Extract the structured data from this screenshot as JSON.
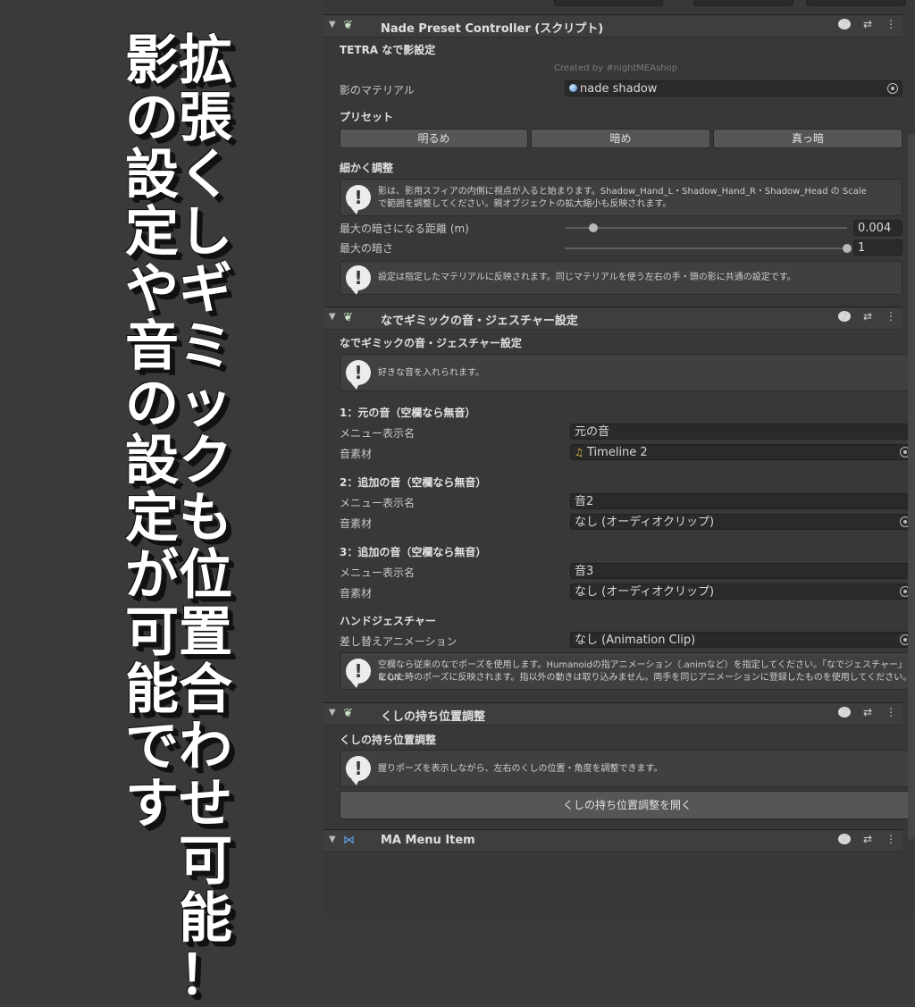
{
  "overlay": {
    "col1": [
      "影",
      "の",
      "設",
      "定",
      "や",
      "音",
      "の",
      "設",
      "定",
      "が",
      "可",
      "能",
      "で",
      "す"
    ],
    "col2": [
      "拡",
      "張",
      "く",
      "し",
      "ギ",
      "ミ",
      "ッ",
      "ク",
      "も",
      "位",
      "置",
      "合",
      "わ",
      "せ",
      "可",
      "能",
      "！"
    ]
  },
  "comp1": {
    "title": "Nade Preset Controller (スクリプト)",
    "subtitle": "TETRA なで影設定",
    "credit": "Created by #nightMEAshop",
    "material_label": "影のマテリアル",
    "material_value": "nade shadow",
    "preset_label": "プリセット",
    "preset_buttons": [
      "明るめ",
      "暗め",
      "真っ暗"
    ],
    "fine_label": "細かく調整",
    "help1_line1": "影は、影用スフィアの内側に視点が入ると始まります。Shadow_Hand_L・Shadow_Hand_R・Shadow_Head の Scale",
    "help1_line2": "で範囲を調整してください。親オブジェクトの拡大縮小も反映されます。",
    "dist_label": "最大の暗さになる距離 (m)",
    "dist_value": "0.004",
    "dark_label": "最大の暗さ",
    "dark_value": "1",
    "dist_fraction": 0.1,
    "dark_fraction": 1.0,
    "help2": "設定は指定したマテリアルに反映されます。同じマテリアルを使う左右の手・頭の影に共通の設定です。"
  },
  "comp2": {
    "title": "なでギミックの音・ジェスチャー設定",
    "subtitle": "なでギミックの音・ジェスチャー設定",
    "help": "好きな音を入れられます。",
    "sound1_header": "1：元の音（空欄なら無音）",
    "sound1_menu_label": "メニュー表示名",
    "sound1_menu_value": "元の音",
    "sound1_clip_label": "音素材",
    "sound1_clip_value": "Timeline 2",
    "sound2_header": "2：追加の音（空欄なら無音）",
    "sound2_menu_label": "メニュー表示名",
    "sound2_menu_value": "音2",
    "sound2_clip_label": "音素材",
    "sound2_clip_value": "なし (オーディオクリップ)",
    "sound3_header": "3：追加の音（空欄なら無音）",
    "sound3_menu_label": "メニュー表示名",
    "sound3_menu_value": "音3",
    "sound3_clip_label": "音素材",
    "sound3_clip_value": "なし (オーディオクリップ)",
    "gesture_header": "ハンドジェスチャー",
    "anim_label": "差し替えアニメーション",
    "anim_value": "なし (Animation Clip)",
    "help_gesture_line1": "空欄なら従来のなでポーズを使用します。Humanoidの指アニメーション（.animなど）を指定してください。「なでジェスチャー」をON",
    "help_gesture_line2": "にした時のポーズに反映されます。指以外の動きは取り込みません。両手を同じアニメーションに登録したものを使用してください。"
  },
  "comp3": {
    "title": "くしの持ち位置調整",
    "subtitle": "くしの持ち位置調整",
    "help": "握りポーズを表示しながら、左右のくしの位置・角度を調整できます。",
    "button": "くしの持ち位置調整を開く"
  },
  "comp4": {
    "title": "MA Menu Item"
  },
  "icons": {
    "help": "?",
    "settings": "⇄",
    "more": "⋮",
    "foldout": "▼"
  }
}
